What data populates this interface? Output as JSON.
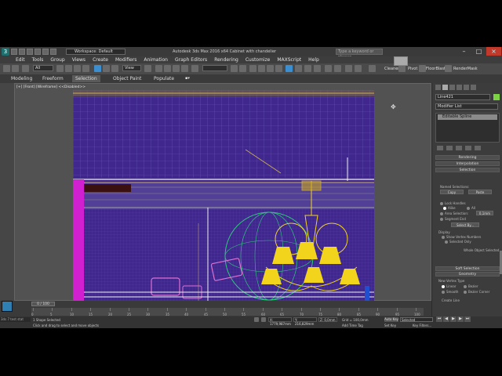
{
  "window": {
    "title": "Autodesk 3ds Max 2016 x64  Cabinet with chandelier",
    "workspace": "Workspace: Default",
    "search_placeholder": "Type a keyword or phrase"
  },
  "menu": [
    "Edit",
    "Tools",
    "Group",
    "Views",
    "Create",
    "Modifiers",
    "Animation",
    "Graph Editors",
    "Rendering",
    "Customize",
    "MAXScript",
    "Help"
  ],
  "toolbar": {
    "selection_filter": "All",
    "view_dropdown": "View",
    "selection_set": "",
    "labels": [
      "Cleaner",
      "Pivot",
      "FloorBlaster",
      "RenderMask"
    ]
  },
  "ribbon": {
    "tabs": [
      "Modeling",
      "Freeform",
      "Selection",
      "Object Paint",
      "Populate"
    ],
    "active_tab": "Selection"
  },
  "viewport": {
    "label": "[+] [Front] [Wireframe]  <<Disabled>>"
  },
  "command_panel": {
    "object_name": "Line421",
    "modifier_list": "Modifier List",
    "stack_item": "Editable Spline",
    "rollouts": {
      "rendering": "Rendering",
      "interpolation": "Interpolation",
      "selection": "Selection",
      "soft_selection": "Soft Selection",
      "geometry": "Geometry"
    },
    "selection": {
      "named_selections": "Named Selections:",
      "copy": "Copy",
      "paste": "Paste",
      "lock_handles": "Lock Handles",
      "alike": "Alike",
      "all": "All",
      "area_selection": "Area Selection:",
      "area_value": "0,1mm",
      "segment_end": "Segment End",
      "select_by": "Select By...",
      "display": "Display",
      "show_vertex_numbers": "Show Vertex Numbers",
      "selected_only": "Selected Only",
      "status": "Whole Object Selected"
    },
    "geometry": {
      "new_vertex_type": "New Vertex Type",
      "linear": "Linear",
      "bezier": "Bezier",
      "smooth": "Smooth",
      "bezier_corner": "Bezier Corner",
      "create_line": "Create Line"
    }
  },
  "timeline": {
    "frame": "0 / 100",
    "ticks": [
      "0",
      "5",
      "10",
      "15",
      "20",
      "25",
      "30",
      "35",
      "40",
      "45",
      "50",
      "55",
      "60",
      "65",
      "70",
      "75",
      "80",
      "85",
      "90",
      "95",
      "100"
    ]
  },
  "statusbar": {
    "script_prompt": "3ds 7 test stat",
    "shape_selected": "1 Shape Selected",
    "prompt": "Click and drag to select and move objects",
    "x": "X: 1779,987mm",
    "y": "Y: 216,829mm",
    "z": "Z: 0,0mm",
    "grid": "Grid = 100,0mm",
    "add_time_tag": "Add Time Tag",
    "auto_key": "Auto Key",
    "set_key": "Set Key",
    "selected": "Selected",
    "key_filters": "Key Filters..."
  },
  "colors": {
    "viewport_bg": "#40278e",
    "selected_object": "#ffffff",
    "chandelier": "#f2d41c",
    "lamp_green": "#2ec87a",
    "magenta_wall": "#d020d0",
    "accent_blue": "#3b8ed0"
  }
}
